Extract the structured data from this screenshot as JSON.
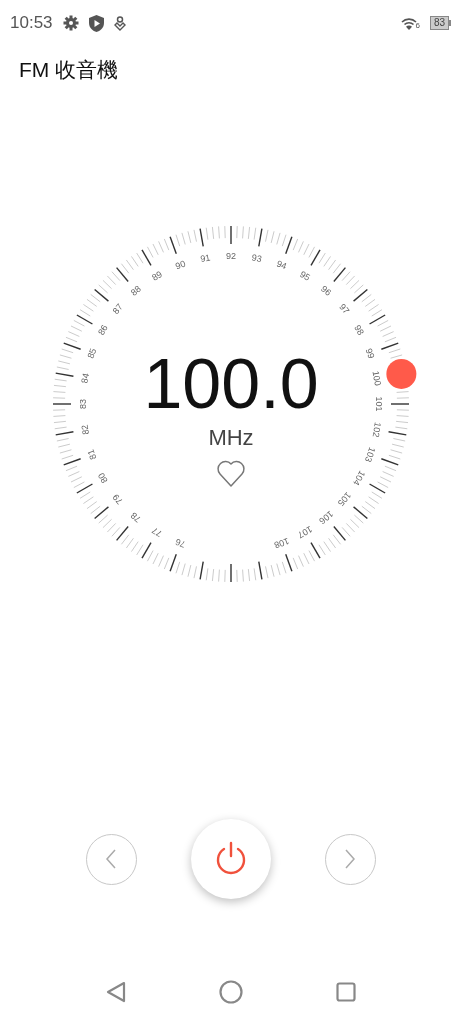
{
  "status_bar": {
    "time": "10:53",
    "wifi_label": "6",
    "battery": "83"
  },
  "app_title": "FM 收音機",
  "dial": {
    "frequency": "100.0",
    "unit": "MHz",
    "favorite": false,
    "scale_labels": [
      "76",
      "77",
      "78",
      "79",
      "80",
      "81",
      "82",
      "83",
      "84",
      "85",
      "86",
      "87",
      "88",
      "89",
      "90",
      "91",
      "92",
      "93",
      "94",
      "95",
      "96",
      "97",
      "98",
      "99",
      "100",
      "101",
      "102",
      "103",
      "104",
      "105",
      "106",
      "107",
      "108"
    ]
  },
  "controls": {
    "power_on": true
  }
}
